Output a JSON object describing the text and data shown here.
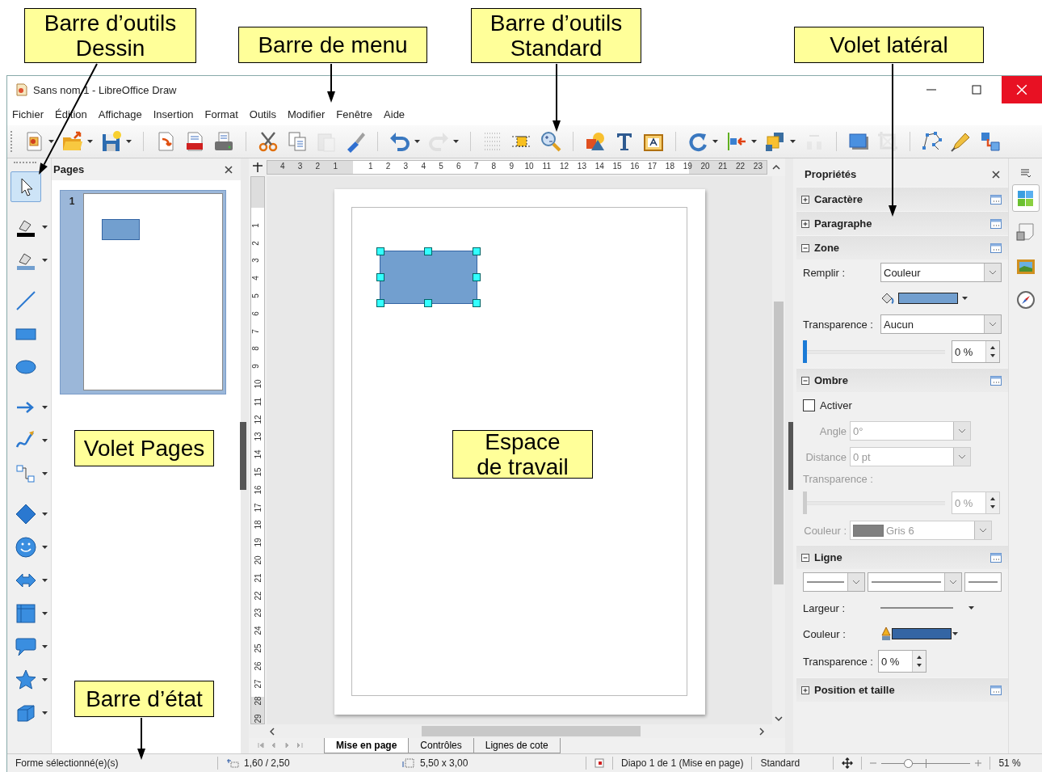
{
  "callouts": [
    {
      "text": "Barre d’outils\nDessin"
    },
    {
      "text": "Barre de menu"
    },
    {
      "text": "Barre d’outils\nStandard"
    },
    {
      "text": "Volet latéral"
    },
    {
      "text": "Volet Pages"
    },
    {
      "text": "Espace\nde travail"
    },
    {
      "text": "Barre d’état"
    }
  ],
  "window": {
    "title": "Sans nom 1 - LibreOffice Draw"
  },
  "menu": [
    "Fichier",
    "Édition",
    "Affichage",
    "Insertion",
    "Format",
    "Outils",
    "Modifier",
    "Fenêtre",
    "Aide"
  ],
  "standard_toolbar": [
    {
      "kind": "new",
      "disabled": false,
      "has_menu": true
    },
    {
      "kind": "open",
      "disabled": false,
      "has_menu": true
    },
    {
      "kind": "save",
      "disabled": false,
      "has_menu": true
    },
    {
      "kind": "export",
      "disabled": false,
      "has_menu": false
    },
    {
      "kind": "pdf",
      "disabled": false,
      "has_menu": false
    },
    {
      "kind": "print",
      "disabled": false,
      "has_menu": false
    },
    {
      "kind": "cut",
      "disabled": false,
      "has_menu": false
    },
    {
      "kind": "copy",
      "disabled": false,
      "has_menu": false
    },
    {
      "kind": "paste",
      "disabled": true,
      "has_menu": false
    },
    {
      "kind": "clone",
      "disabled": false,
      "has_menu": false
    },
    {
      "kind": "undo",
      "disabled": false,
      "has_menu": true
    },
    {
      "kind": "redo",
      "disabled": true,
      "has_menu": true
    },
    {
      "kind": "grid",
      "disabled": false,
      "has_menu": false
    },
    {
      "kind": "helplines",
      "disabled": false,
      "has_menu": false
    },
    {
      "kind": "zoom",
      "disabled": false,
      "has_menu": false
    },
    {
      "kind": "shapes",
      "disabled": false,
      "has_menu": false
    },
    {
      "kind": "text",
      "disabled": false,
      "has_menu": false
    },
    {
      "kind": "textframe",
      "disabled": false,
      "has_menu": false
    },
    {
      "kind": "rotate",
      "disabled": false,
      "has_menu": true
    },
    {
      "kind": "align",
      "disabled": false,
      "has_menu": true
    },
    {
      "kind": "arrange",
      "disabled": false,
      "has_menu": true
    },
    {
      "kind": "distribute",
      "disabled": true,
      "has_menu": false
    },
    {
      "kind": "shadow",
      "disabled": false,
      "has_menu": false
    },
    {
      "kind": "crop",
      "disabled": true,
      "has_menu": false
    },
    {
      "kind": "points",
      "disabled": false,
      "has_menu": false
    },
    {
      "kind": "glue",
      "disabled": false,
      "has_menu": false
    },
    {
      "kind": "cubes",
      "disabled": false,
      "has_menu": false
    }
  ],
  "drawing_toolbar": [
    {
      "kind": "select",
      "selected": true,
      "has_menu": false
    },
    {
      "kind": "line-color",
      "selected": false,
      "has_menu": true
    },
    {
      "kind": "fill-color",
      "selected": false,
      "has_menu": true
    },
    {
      "kind": "line",
      "selected": false,
      "has_menu": false
    },
    {
      "kind": "rectangle",
      "selected": false,
      "has_menu": false
    },
    {
      "kind": "ellipse",
      "selected": false,
      "has_menu": false
    },
    {
      "kind": "arrow",
      "selected": false,
      "has_menu": true
    },
    {
      "kind": "curve",
      "selected": false,
      "has_menu": true
    },
    {
      "kind": "connector",
      "selected": false,
      "has_menu": true
    },
    {
      "kind": "diamond",
      "selected": false,
      "has_menu": true
    },
    {
      "kind": "smiley",
      "selected": false,
      "has_menu": true
    },
    {
      "kind": "double-arrow",
      "selected": false,
      "has_menu": true
    },
    {
      "kind": "flowchart",
      "selected": false,
      "has_menu": true
    },
    {
      "kind": "callout",
      "selected": false,
      "has_menu": true
    },
    {
      "kind": "star",
      "selected": false,
      "has_menu": true
    },
    {
      "kind": "cube",
      "selected": false,
      "has_menu": true
    }
  ],
  "pages_pane": {
    "title": "Pages",
    "slides": [
      {
        "number": "1",
        "selected": true
      }
    ]
  },
  "rulers": {
    "before_origin": [
      "4",
      "3",
      "2",
      "1"
    ],
    "after_origin": [
      "1",
      "2",
      "3",
      "4",
      "5",
      "6",
      "7",
      "8",
      "9",
      "10",
      "11",
      "12",
      "13",
      "14",
      "15",
      "16",
      "17",
      "18",
      "19",
      "20",
      "21",
      "22",
      "23"
    ],
    "vertical": [
      "1",
      "2",
      "3",
      "4",
      "5",
      "6",
      "7",
      "8",
      "9",
      "10",
      "11",
      "12",
      "13",
      "14",
      "15",
      "16",
      "17",
      "18",
      "19",
      "20",
      "21",
      "22",
      "23",
      "24",
      "25",
      "26",
      "27",
      "28",
      "29"
    ]
  },
  "canvas": {
    "shape": {
      "kind": "rectangle",
      "selected": true
    }
  },
  "layout_tabs": [
    {
      "label": "Mise en page",
      "selected": true
    },
    {
      "label": "Contrôles",
      "selected": false
    },
    {
      "label": "Lignes de cote",
      "selected": false
    }
  ],
  "sidebar": {
    "title": "Propriétés",
    "sections": [
      {
        "title": "Caractère",
        "expanded": false
      },
      {
        "title": "Paragraphe",
        "expanded": false
      },
      {
        "title": "Zone",
        "expanded": true,
        "rows": [
          {
            "kind": "dropdown",
            "label": "Remplir :",
            "value": "Couleur",
            "disabled": false
          },
          {
            "kind": "fill-color",
            "color": "#729fcf"
          },
          {
            "kind": "dropdown",
            "label": "Transparence :",
            "value": "Aucun",
            "disabled": false
          },
          {
            "kind": "slider",
            "level": 0,
            "value": "0 %",
            "disabled": false
          }
        ]
      },
      {
        "title": "Ombre",
        "expanded": true,
        "rows": [
          {
            "kind": "checkbox",
            "label": "Activer",
            "checked": false
          },
          {
            "kind": "dropdown",
            "label": "Angle",
            "value": "0°",
            "disabled": true
          },
          {
            "kind": "dropdown",
            "label": "Distance",
            "value": "0 pt",
            "disabled": true
          },
          {
            "kind": "label",
            "label": "Transparence :",
            "disabled": true
          },
          {
            "kind": "slider",
            "level": 0,
            "value": "0 %",
            "disabled": true
          },
          {
            "kind": "color-dropdown",
            "label": "Couleur :",
            "color": "#808080",
            "value": "Gris 6",
            "disabled": true
          }
        ]
      },
      {
        "title": "Ligne",
        "expanded": true,
        "rows": [
          {
            "kind": "line-styles"
          },
          {
            "kind": "line-width",
            "label": "Largeur :"
          },
          {
            "kind": "line-color",
            "label": "Couleur :",
            "color": "#3465a4"
          },
          {
            "kind": "spin",
            "label": "Transparence :",
            "value": "0 %",
            "disabled": false
          }
        ]
      },
      {
        "title": "Position et taille",
        "expanded": false
      }
    ]
  },
  "status_bar": {
    "selection": "Forme sélectionné(e)(s)",
    "position": "1,60 / 2,50",
    "size": "5,50 x 3,00",
    "slide": "Diapo 1 de 1 (Mise en page)",
    "master": "Standard",
    "zoom_slider": {
      "level": 0.3
    },
    "zoom": "51 %"
  }
}
